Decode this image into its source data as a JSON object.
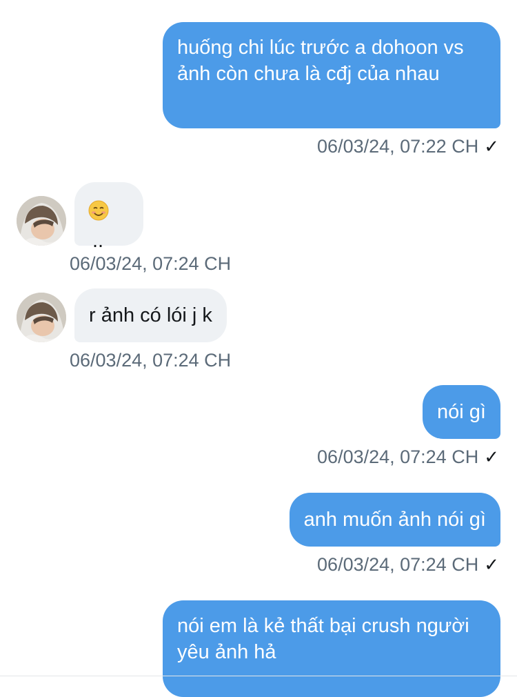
{
  "messages": [
    {
      "direction": "out",
      "text": "huống chi lúc trước a dohoon vs ảnh còn chưa là cđj của nhau",
      "timestamp": "06/03/24, 07:22 CH",
      "read_icon": "checkmark-icon"
    },
    {
      "direction": "in",
      "text": "..",
      "emoji": "smiling-face-emoji",
      "timestamp": "06/03/24, 07:24 CH"
    },
    {
      "direction": "in",
      "text": "r ảnh có lói j k",
      "timestamp": "06/03/24, 07:24 CH"
    },
    {
      "direction": "out",
      "text": "nói gì",
      "timestamp": "06/03/24, 07:24 CH",
      "read_icon": "checkmark-icon"
    },
    {
      "direction": "out",
      "text": "anh muốn ảnh nói gì",
      "timestamp": "06/03/24, 07:24 CH",
      "read_icon": "checkmark-icon"
    },
    {
      "direction": "out",
      "text": "nói em là kẻ thất bại crush người yêu ảnh hả"
    }
  ],
  "colors": {
    "outgoing_bubble": "#4c9be8",
    "incoming_bubble": "#eef1f4",
    "timestamp_text": "#5b6a78"
  },
  "icons": {
    "checkmark": "✓"
  }
}
